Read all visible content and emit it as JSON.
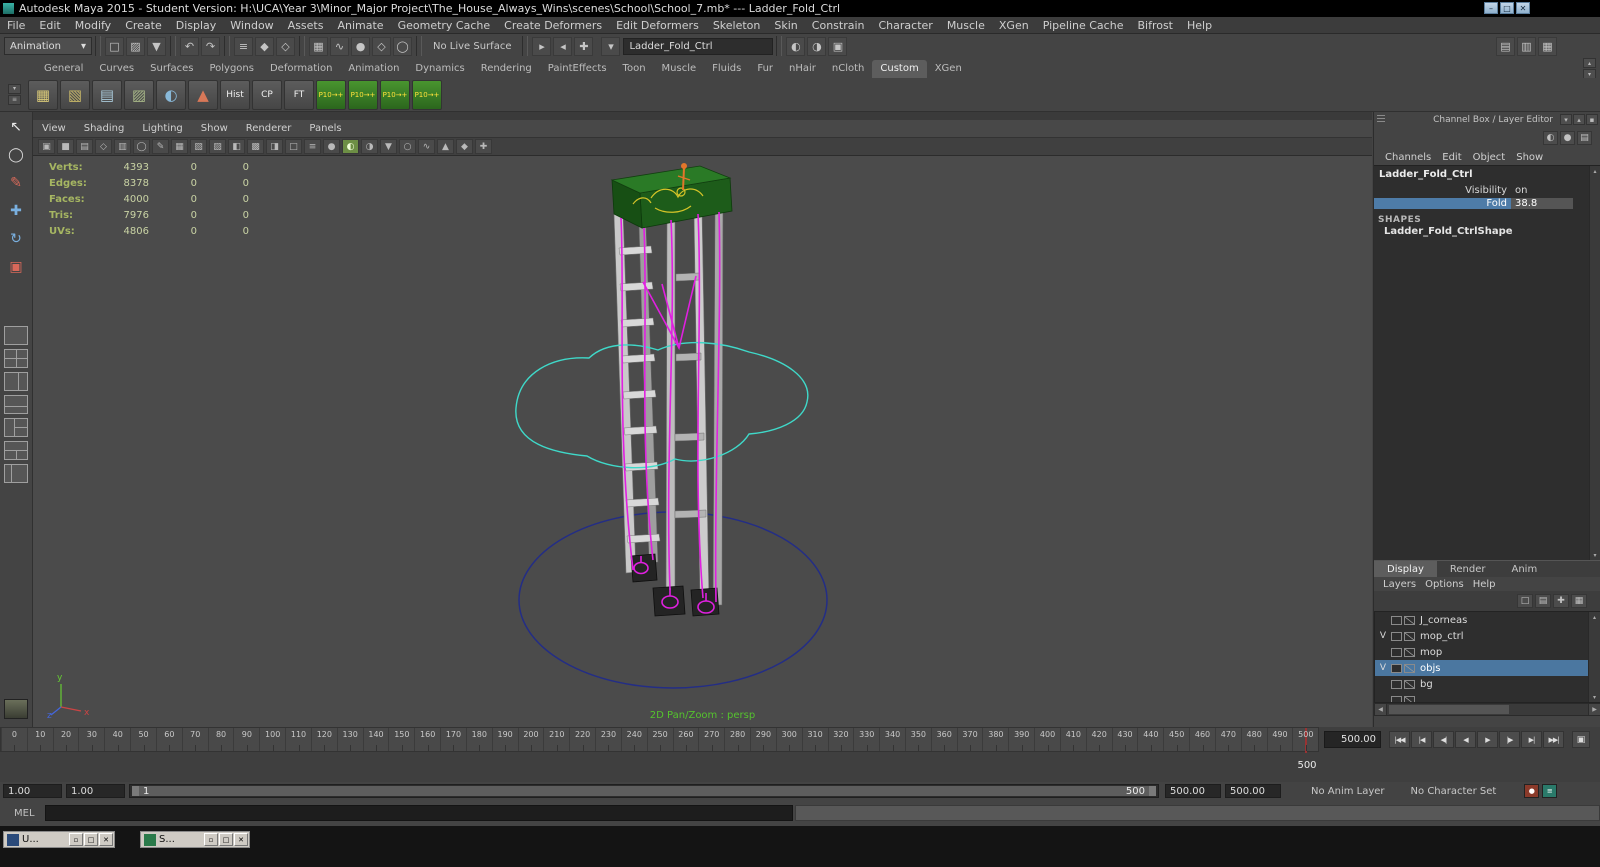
{
  "window": {
    "title": "Autodesk Maya 2015 - Student Version: H:\\UCA\\Year 3\\Minor_Major Project\\The_House_Always_Wins\\scenes\\School\\School_7.mb*   ---   Ladder_Fold_Ctrl",
    "controls": [
      {
        "name": "minimize-button",
        "glyph": "–"
      },
      {
        "name": "maximize-button",
        "glyph": "□"
      },
      {
        "name": "close-button",
        "glyph": "✕"
      }
    ]
  },
  "glyphs": {
    "caret_down": "▾",
    "caret_up": "▴",
    "arrow_left": "◀",
    "arrow_right": "▶",
    "menu_lines": "≡"
  },
  "menu_bar": [
    "File",
    "Edit",
    "Modify",
    "Create",
    "Display",
    "Window",
    "Assets",
    "Animate",
    "Geometry Cache",
    "Create Deformers",
    "Edit Deformers",
    "Skeleton",
    "Skin",
    "Constrain",
    "Character",
    "Muscle",
    "XGen",
    "Pipeline Cache",
    "Bifrost",
    "Help"
  ],
  "status_line": {
    "mode": "Animation",
    "no_live_surface": "No Live Surface",
    "selection_field": "Ladder_Fold_Ctrl",
    "icons_file": [
      {
        "name": "new-scene-icon",
        "glyph": "□"
      },
      {
        "name": "open-scene-icon",
        "glyph": "▨"
      },
      {
        "name": "save-scene-icon",
        "glyph": "▼"
      }
    ],
    "icons_undo": [
      {
        "name": "undo-icon",
        "glyph": "↶"
      },
      {
        "name": "redo-icon",
        "glyph": "↷"
      }
    ],
    "icons_selection": [
      {
        "name": "select-hierarchy-icon",
        "glyph": "≡"
      },
      {
        "name": "select-object-icon",
        "glyph": "◆"
      },
      {
        "name": "select-component-icon",
        "glyph": "◇"
      }
    ],
    "icons_snap": [
      {
        "name": "snap-to-grid-icon",
        "glyph": "▦"
      },
      {
        "name": "snap-to-curve-icon",
        "glyph": "∿"
      },
      {
        "name": "snap-to-point-icon",
        "glyph": "●"
      },
      {
        "name": "snap-to-plane-icon",
        "glyph": "◇"
      },
      {
        "name": "make-live-icon",
        "glyph": "◯"
      }
    ],
    "icons_history": [
      {
        "name": "input-connections-icon",
        "glyph": "▸"
      },
      {
        "name": "output-connections-icon",
        "glyph": "◂"
      },
      {
        "name": "construction-history-icon",
        "glyph": "✚"
      }
    ],
    "icons_render": [
      {
        "name": "render-current-frame-icon",
        "glyph": "◐"
      },
      {
        "name": "ipr-render-icon",
        "glyph": "◑"
      },
      {
        "name": "render-settings-icon",
        "glyph": "▣"
      }
    ],
    "icons_sidebar": [
      {
        "name": "attribute-editor-toggle-icon",
        "glyph": "▤"
      },
      {
        "name": "tool-settings-toggle-icon",
        "glyph": "▥"
      },
      {
        "name": "channel-box-toggle-icon",
        "glyph": "▦"
      }
    ]
  },
  "shelf": {
    "tabs": [
      "General",
      "Curves",
      "Surfaces",
      "Polygons",
      "Deformation",
      "Animation",
      "Dynamics",
      "Rendering",
      "PaintEffects",
      "Toon",
      "Muscle",
      "Fluids",
      "Fur",
      "nHair",
      "nCloth",
      "Custom",
      "XGen"
    ],
    "active_tab": "Custom",
    "icon_buttons": [
      {
        "name": "shelf-poly-plane-icon",
        "glyph": "▦",
        "fg": "#d8c878"
      },
      {
        "name": "shelf-poly-cube-icon",
        "glyph": "▧",
        "fg": "#c8b868"
      },
      {
        "name": "shelf-lattice-icon",
        "glyph": "▤",
        "fg": "#a8c8d8"
      },
      {
        "name": "shelf-mesh-icon",
        "glyph": "▨",
        "fg": "#a8b888"
      },
      {
        "name": "shelf-smooth-icon",
        "glyph": "◐",
        "fg": "#88b8d8"
      },
      {
        "name": "shelf-brush-icon",
        "glyph": "▲",
        "fg": "#d87858"
      }
    ],
    "text_buttons": [
      "Hist",
      "CP",
      "FT"
    ],
    "green_button_label": "P10→+",
    "green_button_count": 4
  },
  "toolbox": {
    "tools": [
      {
        "name": "select-tool",
        "glyph": "↖",
        "color": "#e8e8e8"
      },
      {
        "name": "lasso-select-tool",
        "glyph": "◯",
        "color": "#d8d8d8"
      },
      {
        "name": "paint-select-tool",
        "glyph": "✎",
        "color": "#d86a5a"
      },
      {
        "name": "move-tool",
        "glyph": "✚",
        "color": "#7ab0e0"
      },
      {
        "name": "rotate-tool",
        "glyph": "↻",
        "color": "#7ab0e0"
      },
      {
        "name": "scale-tool",
        "glyph": "▣",
        "color": "#d8685a"
      }
    ],
    "layouts": [
      "single",
      "four",
      "two-v",
      "two-h",
      "three-l",
      "three-b",
      "outliner"
    ]
  },
  "viewport": {
    "menus": [
      "View",
      "Shading",
      "Lighting",
      "Show",
      "Renderer",
      "Panels"
    ],
    "toolbar_icons": [
      {
        "name": "select-camera-icon",
        "glyph": "▣"
      },
      {
        "name": "lock-camera-icon",
        "glyph": "■"
      },
      {
        "name": "camera-attributes-icon",
        "glyph": "▤"
      },
      {
        "name": "bookmarks-icon",
        "glyph": "◇"
      },
      {
        "name": "image-plane-icon",
        "glyph": "▥"
      },
      {
        "name": "two-d-pan-zoom-icon",
        "glyph": "◯"
      },
      {
        "name": "grease-pencil-icon",
        "glyph": "✎"
      },
      {
        "name": "grid-icon",
        "glyph": "▦"
      },
      {
        "name": "film-gate-icon",
        "glyph": "▧"
      },
      {
        "name": "resolution-gate-icon",
        "glyph": "▨"
      },
      {
        "name": "gate-mask-icon",
        "glyph": "◧"
      },
      {
        "name": "field-chart-icon",
        "glyph": "▩"
      },
      {
        "name": "safe-action-icon",
        "glyph": "◨"
      },
      {
        "name": "safe-title-icon",
        "glyph": "□"
      },
      {
        "name": "wireframe-icon",
        "glyph": "≡"
      },
      {
        "name": "shaded-mode-icon",
        "glyph": "●"
      },
      {
        "name": "textured-mode-icon",
        "glyph": "◐",
        "active": true
      },
      {
        "name": "use-all-lights-icon",
        "glyph": "◑"
      },
      {
        "name": "shadows-icon",
        "glyph": "▼"
      },
      {
        "name": "occlusion-icon",
        "glyph": "○"
      },
      {
        "name": "motion-blur-icon",
        "glyph": "∿"
      },
      {
        "name": "multisample-icon",
        "glyph": "▲"
      },
      {
        "name": "isolate-select-icon",
        "glyph": "◆"
      },
      {
        "name": "xray-icon",
        "glyph": "✚"
      }
    ],
    "hud": [
      {
        "label": "Verts:",
        "value": "4393",
        "c2": "0",
        "c3": "0"
      },
      {
        "label": "Edges:",
        "value": "8378",
        "c2": "0",
        "c3": "0"
      },
      {
        "label": "Faces:",
        "value": "4000",
        "c2": "0",
        "c3": "0"
      },
      {
        "label": "Tris:",
        "value": "7976",
        "c2": "0",
        "c3": "0"
      },
      {
        "label": "UVs:",
        "value": "4806",
        "c2": "0",
        "c3": "0"
      }
    ],
    "overlay": "2D Pan/Zoom : persp",
    "axis_labels": {
      "x": "x",
      "y": "y",
      "z": "z"
    }
  },
  "panel_header": {
    "title": "Channel Box / Layer Editor",
    "icons": [
      {
        "name": "panel-menu-icon",
        "glyph": "▾"
      },
      {
        "name": "panel-float-icon",
        "glyph": "▴"
      },
      {
        "name": "panel-close-icon",
        "glyph": "▪"
      }
    ],
    "icons2": [
      {
        "name": "speed-slider-icon",
        "glyph": "◐"
      },
      {
        "name": "hyperbolic-icon",
        "glyph": "●"
      },
      {
        "name": "manip-mode-icon",
        "glyph": "▤"
      }
    ]
  },
  "channel_box": {
    "menus": [
      "Channels",
      "Edit",
      "Object",
      "Show"
    ],
    "object_name": "Ladder_Fold_Ctrl",
    "attributes": [
      {
        "name": "Visibility",
        "value": "on",
        "highlighted": false
      },
      {
        "name": "Fold",
        "value": "38.8",
        "highlighted": true
      }
    ],
    "shapes_heading": "SHAPES",
    "shape_name": "Ladder_Fold_CtrlShape"
  },
  "layer_editor": {
    "tabs": [
      "Display",
      "Render",
      "Anim"
    ],
    "active_tab": "Display",
    "menus": [
      "Layers",
      "Options",
      "Help"
    ],
    "icons": [
      {
        "name": "layer-empty-icon",
        "glyph": "□"
      },
      {
        "name": "layer-stack-icon",
        "glyph": "▤"
      },
      {
        "name": "new-empty-layer-icon",
        "glyph": "✚"
      },
      {
        "name": "new-layer-from-selected-icon",
        "glyph": "▦"
      }
    ],
    "layers": [
      {
        "v": "",
        "name": "J_corneas",
        "selected": false
      },
      {
        "v": "V",
        "name": "mop_ctrl",
        "selected": false
      },
      {
        "v": "",
        "name": "mop",
        "selected": false
      },
      {
        "v": "V",
        "name": "objs",
        "selected": true
      },
      {
        "v": "",
        "name": "bg",
        "selected": false
      }
    ],
    "clipped_row": true
  },
  "timeline": {
    "tick_start": 0,
    "tick_end": 500,
    "tick_step": 10,
    "current_frame_label": "500",
    "current_time": "500.00"
  },
  "transport": [
    {
      "name": "go-to-start",
      "glyph": "|◀◀"
    },
    {
      "name": "step-back-frame",
      "glyph": "|◀"
    },
    {
      "name": "step-back-key",
      "glyph": "◀|"
    },
    {
      "name": "play-backwards",
      "glyph": "◀"
    },
    {
      "name": "play-forwards",
      "glyph": "▶"
    },
    {
      "name": "step-forward-key",
      "glyph": "|▶"
    },
    {
      "name": "step-forward-frame",
      "glyph": "▶|"
    },
    {
      "name": "go-to-end",
      "glyph": "▶▶|"
    }
  ],
  "range_slider": {
    "anim_start": "1.00",
    "playback_start": "1.00",
    "bar_start_label": "1",
    "bar_end_label": "500",
    "playback_end": "500.00",
    "anim_end": "500.00",
    "anim_layer": "No Anim Layer",
    "character_set": "No Character Set"
  },
  "command_line": {
    "label": "MEL"
  },
  "taskbar": {
    "windows": [
      {
        "label": "U...",
        "icon_color": "#2a4a7a"
      },
      {
        "label": "S...",
        "icon_color": "#2a7a4a"
      }
    ],
    "window_buttons": [
      {
        "name": "restore-button",
        "glyph": "▫"
      },
      {
        "name": "maximize-button",
        "glyph": "□"
      },
      {
        "name": "close-button",
        "glyph": "✕"
      }
    ]
  },
  "colors": {
    "highlight_blue": "#4e7ca8",
    "selection_blue": "#4b77a0",
    "hud_green": "#a6b662",
    "overlay_green": "#55c32e",
    "curve_magenta": "#e020e0",
    "curve_cyan": "#3fd9c9",
    "ellipse_blue": "#232d86",
    "ladder_top_green": "#1d5c1a",
    "autokey_red": "#8a3a2a",
    "prefs_teal": "#2a7a6a"
  }
}
